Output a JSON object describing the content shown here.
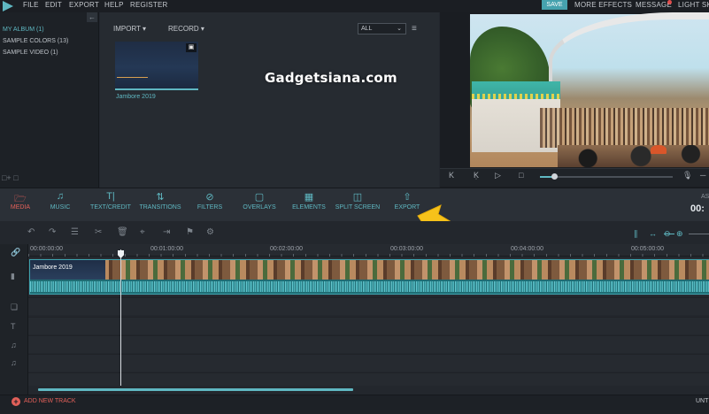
{
  "menu": {
    "items": [
      "FILE",
      "EDIT",
      "EXPORT",
      "HELP",
      "REGISTER"
    ],
    "save": "SAVE",
    "more_effects": "MORE EFFECTS",
    "message": "MESSAGE",
    "light": "LIGHT SK"
  },
  "library": {
    "albums": [
      "MY ALBUM (1)",
      "SAMPLE COLORS (13)",
      "SAMPLE VIDEO (1)"
    ],
    "back_icon": "←",
    "import": "IMPORT",
    "record": "RECORD",
    "filter": "ALL",
    "clip_name": "Jambore 2019"
  },
  "watermark": "Gadgetsiana.com",
  "preview_controls": [
    "K",
    "Ḳ",
    "▷",
    "□"
  ],
  "toolbar": {
    "media": "MEDIA",
    "music": "MUSIC",
    "text": "TEXT/CREDIT",
    "transitions": "TRANSITIONS",
    "filters": "FILTERS",
    "overlays": "OVERLAYS",
    "elements": "ELEMENTS",
    "split": "SPLIT SCREEN",
    "export": "EXPORT",
    "as": "AS",
    "time": "00:"
  },
  "timeline": {
    "ruler": [
      "00:00:00:00",
      "00:01:00:00",
      "00:02:00:00",
      "00:03:00:00",
      "00:04:00:00",
      "00:05:00:00"
    ],
    "clip_name": "Jambore 2019"
  },
  "footer": {
    "add_track": "ADD NEW TRACK",
    "untitled": "UNT"
  },
  "colors": {
    "accent": "#5fb8c2",
    "active": "#e26059",
    "arrow": "#f6c21a"
  }
}
